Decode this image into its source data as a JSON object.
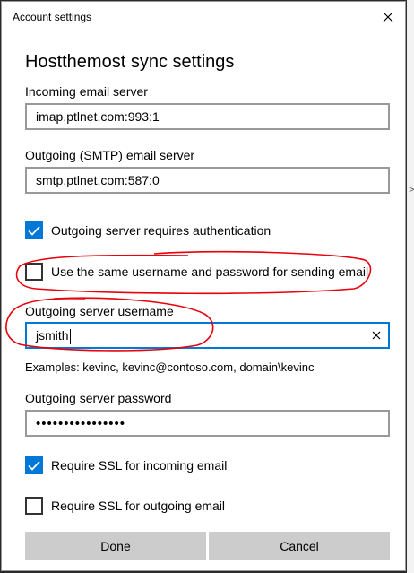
{
  "window": {
    "title": "Account settings"
  },
  "heading": "Hostthemost sync settings",
  "incoming": {
    "label": "Incoming email server",
    "value": "imap.ptlnet.com:993:1"
  },
  "outgoing": {
    "label": "Outgoing (SMTP) email server",
    "value": "smtp.ptlnet.com:587:0"
  },
  "checkboxes": {
    "requires_auth": {
      "label": "Outgoing server requires authentication",
      "checked": true
    },
    "same_credentials": {
      "label": "Use the same username and password for sending email",
      "checked": false
    },
    "ssl_incoming": {
      "label": "Require SSL for incoming email",
      "checked": true
    },
    "ssl_outgoing": {
      "label": "Require SSL for outgoing email",
      "checked": false
    }
  },
  "username": {
    "label": "Outgoing server username",
    "value": "jsmith"
  },
  "examples": "Examples: kevinc, kevinc@contoso.com, domain\\kevinc",
  "password": {
    "label": "Outgoing server password",
    "value": "••••••••••••••••"
  },
  "buttons": {
    "done": "Done",
    "cancel": "Cancel"
  },
  "colors": {
    "accent": "#0078d7",
    "annotation": "#e8000b",
    "button_bg": "#cccccc"
  },
  "icons": {
    "close": "close-icon",
    "clear": "clear-icon",
    "check": "checkmark-icon"
  }
}
